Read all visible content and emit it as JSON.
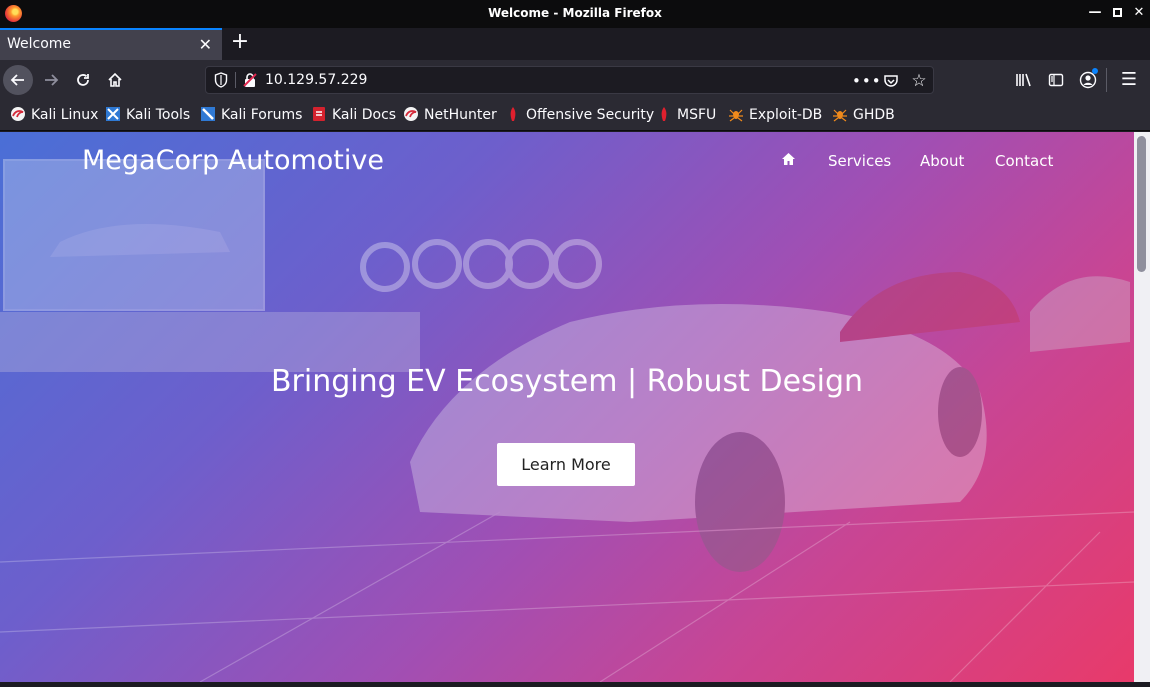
{
  "window": {
    "title": "Welcome - Mozilla Firefox"
  },
  "tabs": [
    {
      "label": "Welcome",
      "active": true
    }
  ],
  "navbar": {
    "url": "10.129.57.229"
  },
  "bookmarks": [
    {
      "label": "Kali Linux",
      "icon": "kali-dragon-icon"
    },
    {
      "label": "Kali Tools",
      "icon": "kali-tools-icon"
    },
    {
      "label": "Kali Forums",
      "icon": "kali-forums-icon"
    },
    {
      "label": "Kali Docs",
      "icon": "kali-docs-icon"
    },
    {
      "label": "NetHunter",
      "icon": "kali-dragon-icon"
    },
    {
      "label": "Offensive Security",
      "icon": "offsec-icon"
    },
    {
      "label": "MSFU",
      "icon": "offsec-icon"
    },
    {
      "label": "Exploit-DB",
      "icon": "exploitdb-spider-icon"
    },
    {
      "label": "GHDB",
      "icon": "exploitdb-spider-icon"
    }
  ],
  "page": {
    "brand": "MegaCorp Automotive",
    "nav": {
      "home_icon": "home-icon",
      "services": "Services",
      "about": "About",
      "contact": "Contact"
    },
    "hero_title": "Bringing EV Ecosystem | Robust Design",
    "cta_label": "Learn More"
  },
  "colors": {
    "accent": "#0a84ff",
    "hero_gradient_start": "#4a6fd6",
    "hero_gradient_end": "#e83a6a"
  }
}
